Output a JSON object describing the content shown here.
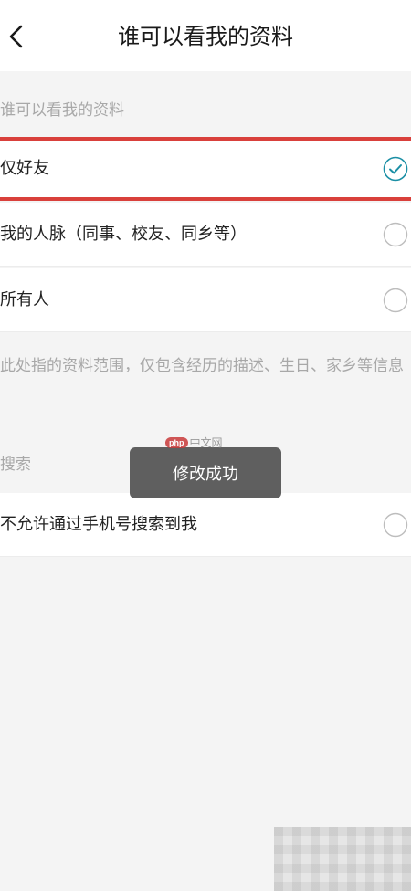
{
  "header": {
    "title": "谁可以看我的资料",
    "back_icon": "chevron-left-icon"
  },
  "visibility_section": {
    "label": "谁可以看我的资料",
    "options": [
      {
        "label": "仅好友",
        "selected": true
      },
      {
        "label": "我的人脉（同事、校友、同乡等）",
        "selected": false
      },
      {
        "label": "所有人",
        "selected": false
      }
    ],
    "note": "此处指的资料范围，仅包含经历的描述、生日、家乡等信息"
  },
  "search_section": {
    "label": "搜索",
    "options": [
      {
        "label": "不允许通过手机号搜索到我",
        "selected": false
      }
    ]
  },
  "toast": {
    "message": "修改成功"
  },
  "watermark": {
    "badge": "php",
    "text": "中文网"
  },
  "colors": {
    "accent": "#1b8fa5",
    "highlight": "#d9403b",
    "muted_text": "#a8a8a8",
    "toast_bg": "#5f5f5f"
  }
}
